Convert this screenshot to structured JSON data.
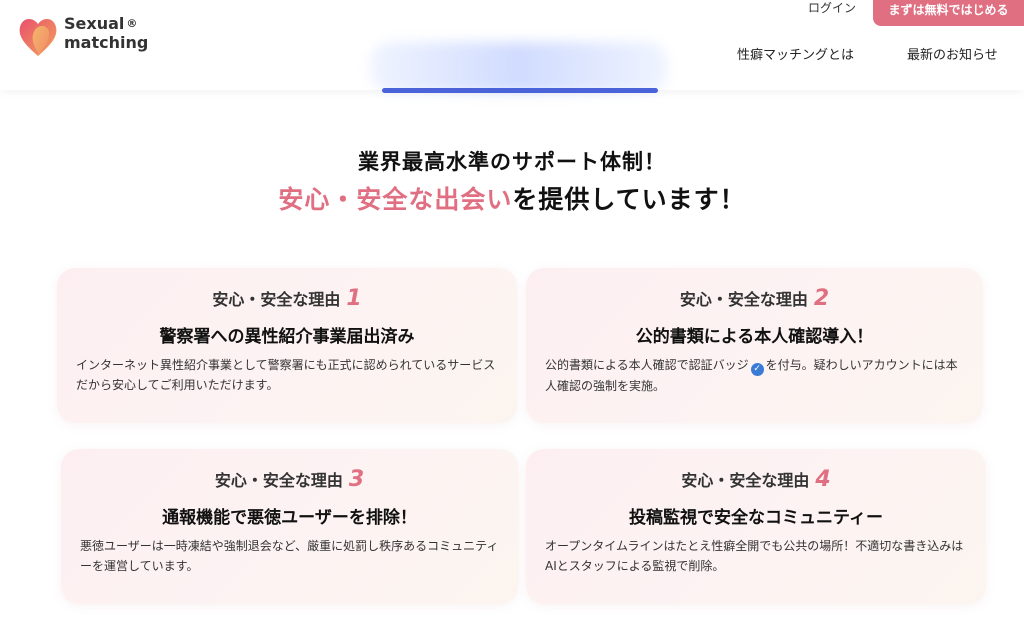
{
  "header": {
    "logo": {
      "line1": "Sexual",
      "line2": "matching",
      "reg": "®"
    },
    "login": "ログイン",
    "cta": "まずは無料ではじめる",
    "nav": {
      "about": "性癖マッチングとは",
      "news": "最新のお知らせ"
    }
  },
  "hero": {
    "line1": "業界最高水準のサポート体制！",
    "line2_accent": "安心・安全な出会い",
    "line2_rest": "を提供しています！"
  },
  "cards": [
    {
      "label": "安心・安全な理由",
      "num": "1",
      "title": "警察署への異性紹介事業届出済み",
      "desc": "インターネット異性紹介事業として警察署にも正式に認められているサービスだから安心してご利用いただけます。"
    },
    {
      "label": "安心・安全な理由",
      "num": "2",
      "title": "公的書類による本人確認導入！",
      "desc_before": "公的書類による本人確認で認証バッジ",
      "desc_after": "を付与。疑わしいアカウントには本人確認の強制を実施。"
    },
    {
      "label": "安心・安全な理由",
      "num": "3",
      "title": "通報機能で悪徳ユーザーを排除！",
      "desc": "悪徳ユーザーは一時凍結や強制退会など、厳重に処罰し秩序あるコミュニティーを運営しています。"
    },
    {
      "label": "安心・安全な理由",
      "num": "4",
      "title": "投稿監視で安全なコミュニティー",
      "desc": "オープンタイムラインはたとえ性癖全開でも公共の場所！不適切な書き込みはAIとスタッフによる監視で削除。"
    }
  ],
  "colors": {
    "accent": "#e06f82",
    "badge": "#3a7bd5",
    "banner_line": "#4b63d8"
  }
}
